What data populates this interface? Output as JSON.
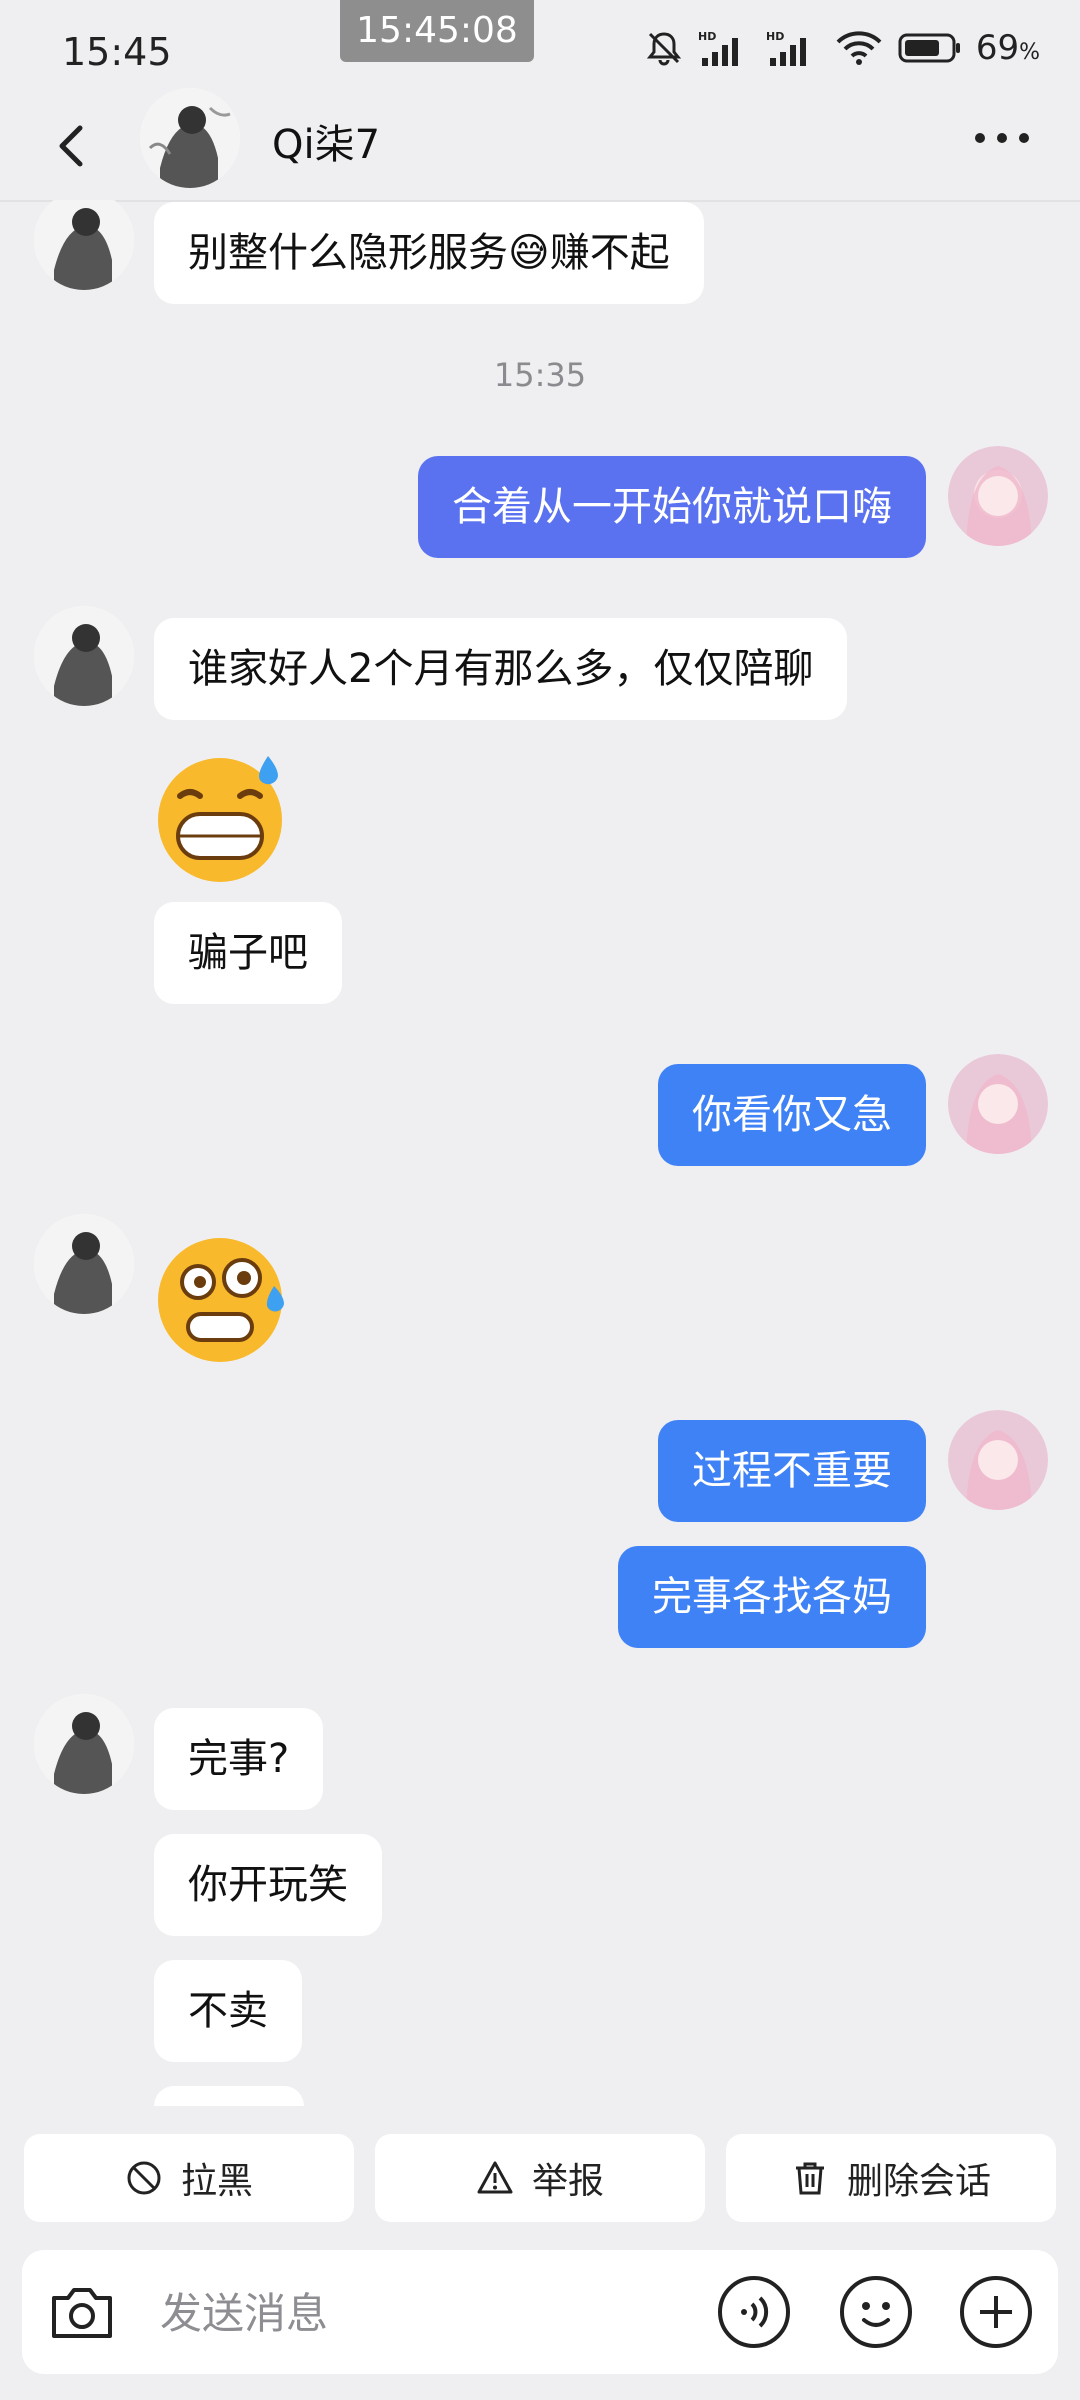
{
  "status": {
    "time": "15:45",
    "screen_clock": "15:45:08",
    "battery_percent": "69",
    "battery_unit": "%"
  },
  "header": {
    "contact_name": "Qi柒7"
  },
  "messages": {
    "m1": "别整什么隐形服务😅赚不起",
    "ts1": "15:35",
    "m2": "合着从一开始你就说口嗨",
    "m3": "谁家好人2个月有那么多，仅仅陪聊",
    "m5": "骗子吧",
    "m6": "你看你又急",
    "m8": "过程不重要",
    "m9": "完事各找各妈",
    "m10": "完事?",
    "m11": "你开玩笑",
    "m12": "不卖"
  },
  "actions": {
    "block": "拉黑",
    "report": "举报",
    "delete": "删除会话"
  },
  "input": {
    "placeholder": "发送消息"
  },
  "icons": [
    "back-icon",
    "more-icon",
    "mute-icon",
    "signal-icon",
    "wifi-icon",
    "battery-icon",
    "block-icon",
    "warning-icon",
    "trash-icon",
    "camera-icon",
    "voice-icon",
    "emoji-icon",
    "plus-icon"
  ]
}
